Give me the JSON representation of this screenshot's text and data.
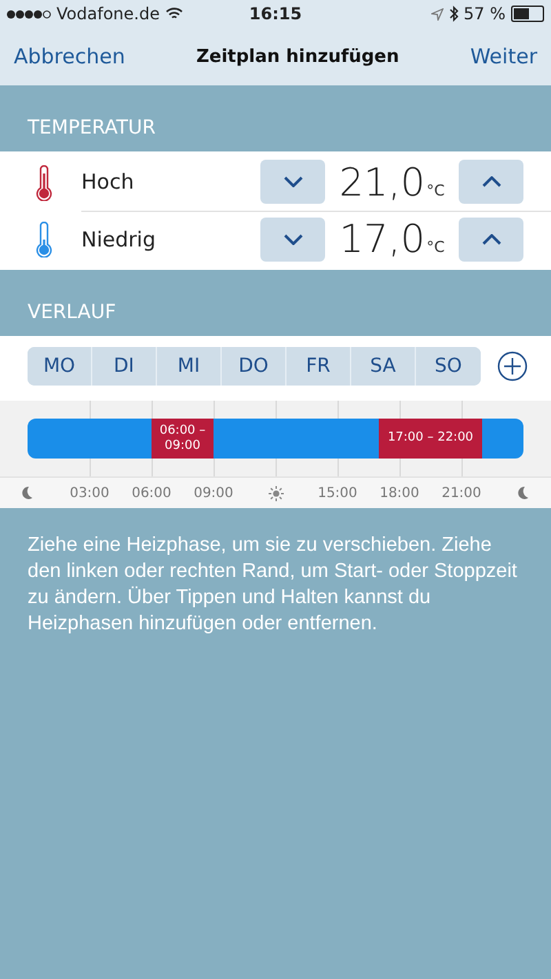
{
  "status_bar": {
    "carrier": "Vodafone.de",
    "time": "16:15",
    "battery": "57 %"
  },
  "nav": {
    "cancel": "Abbrechen",
    "title": "Zeitplan hinzufügen",
    "next": "Weiter"
  },
  "temperature": {
    "header": "TEMPERATUR",
    "rows": [
      {
        "kind": "high",
        "label": "Hoch",
        "value": "21,0",
        "unit": "°C"
      },
      {
        "kind": "low",
        "label": "Niedrig",
        "value": "17,0",
        "unit": "°C"
      }
    ]
  },
  "course": {
    "header": "VERLAUF",
    "days": [
      {
        "label": "MO",
        "selected": false
      },
      {
        "label": "DI",
        "selected": false
      },
      {
        "label": "MI",
        "selected": false
      },
      {
        "label": "DO",
        "selected": false
      },
      {
        "label": "FR",
        "selected": false
      },
      {
        "label": "SA",
        "selected": false
      },
      {
        "label": "SO",
        "selected": false
      }
    ],
    "phases": [
      {
        "start": "06:00",
        "dash": "–",
        "end": "09:00"
      },
      {
        "start": "17:00",
        "dash": "–",
        "end": "22:00"
      }
    ],
    "axis": [
      {
        "kind": "moon"
      },
      {
        "kind": "time",
        "label": "03:00"
      },
      {
        "kind": "time",
        "label": "06:00"
      },
      {
        "kind": "time",
        "label": "09:00"
      },
      {
        "kind": "sun"
      },
      {
        "kind": "time",
        "label": "15:00"
      },
      {
        "kind": "time",
        "label": "18:00"
      },
      {
        "kind": "time",
        "label": "21:00"
      },
      {
        "kind": "moon"
      }
    ]
  },
  "hint": "Ziehe eine Heizphase, um sie zu verschieben. Ziehe den linken oder rechten Rand, um Start- oder Stoppzeit zu ändern. Über Tippen und Halten kannst du Heizphasen hinzufügen oder entfernen."
}
